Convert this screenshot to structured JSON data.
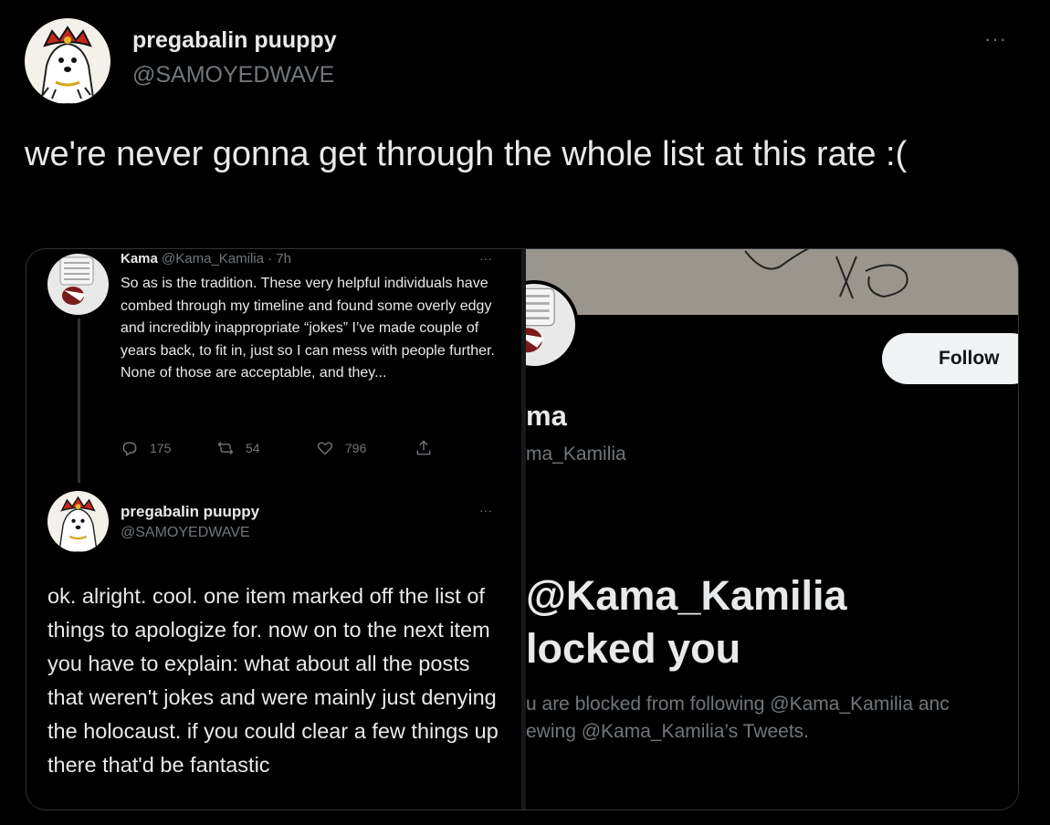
{
  "tweet": {
    "display_name": "pregabalin puuppy",
    "handle": "@SAMOYEDWAVE",
    "more_icon": "···",
    "text": "we're never gonna get through the whole list at this rate :("
  },
  "embedded_left": {
    "quoted": {
      "name": "Kama",
      "meta": "@Kama_Kamilia · 7h",
      "more_icon": "···",
      "text": "So as is the tradition. These very helpful individuals have combed through my timeline and found some overly edgy and incredibly inappropriate “jokes” I’ve made couple of years back, to fit in, just so I can mess with people further. None of those are acceptable, and they...",
      "replies": "175",
      "retweets": "54",
      "likes": "796"
    },
    "reply": {
      "name": "pregabalin puuppy",
      "handle": "@SAMOYEDWAVE",
      "more_icon": "···",
      "text": "ok. alright. cool. one item marked off the list of things to apologize for. now on to the next item you have to explain: what about all the posts that weren't jokes and were mainly just denying the holocaust. if you could clear a few things up there that'd be fantastic"
    }
  },
  "embedded_right": {
    "follow_label": "Follow",
    "name": "ma",
    "handle": "ma_Kamilia",
    "blocked_line1": "@Kama_Kamilia",
    "blocked_line2": "locked you",
    "blocked_sub1": "u are blocked from following @Kama_Kamilia anc",
    "blocked_sub2": "ewing @Kama_Kamilia’s Tweets."
  },
  "colors": {
    "background": "#000000",
    "text": "#e7e9ea",
    "secondary_text": "#71767b",
    "border": "#2f3336",
    "follow_button": "#eff3f4"
  }
}
